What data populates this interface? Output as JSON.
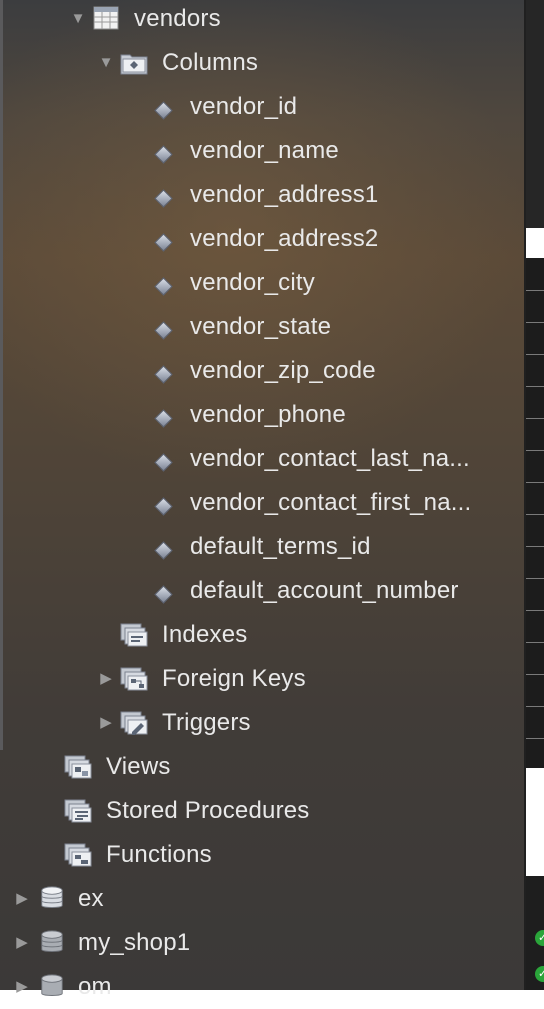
{
  "tree": {
    "table": {
      "name": "vendors",
      "expanded": true,
      "icon": "table-icon"
    },
    "columns_folder": {
      "label": "Columns",
      "expanded": true,
      "icon": "columns-folder-icon"
    },
    "columns": [
      "vendor_id",
      "vendor_name",
      "vendor_address1",
      "vendor_address2",
      "vendor_city",
      "vendor_state",
      "vendor_zip_code",
      "vendor_phone",
      "vendor_contact_last_na...",
      "vendor_contact_first_na...",
      "default_terms_id",
      "default_account_number"
    ],
    "indexes": {
      "label": "Indexes",
      "icon": "indexes-folder-icon"
    },
    "foreign_keys": {
      "label": "Foreign Keys",
      "icon": "foreign-keys-folder-icon"
    },
    "triggers": {
      "label": "Triggers",
      "icon": "triggers-folder-icon"
    },
    "views": {
      "label": "Views",
      "icon": "views-folder-icon"
    },
    "stored_procedures": {
      "label": "Stored Procedures",
      "icon": "stored-procedures-folder-icon"
    },
    "functions": {
      "label": "Functions",
      "icon": "functions-folder-icon"
    },
    "schemas": [
      {
        "name": "ex",
        "icon": "database-icon"
      },
      {
        "name": "my_shop1",
        "icon": "database-icon"
      },
      {
        "name": "om",
        "icon": "database-icon"
      }
    ]
  },
  "colors": {
    "text": "#e9e9e9",
    "disclosure": "#9a9a9a",
    "status_ok": "#2aa53a"
  }
}
